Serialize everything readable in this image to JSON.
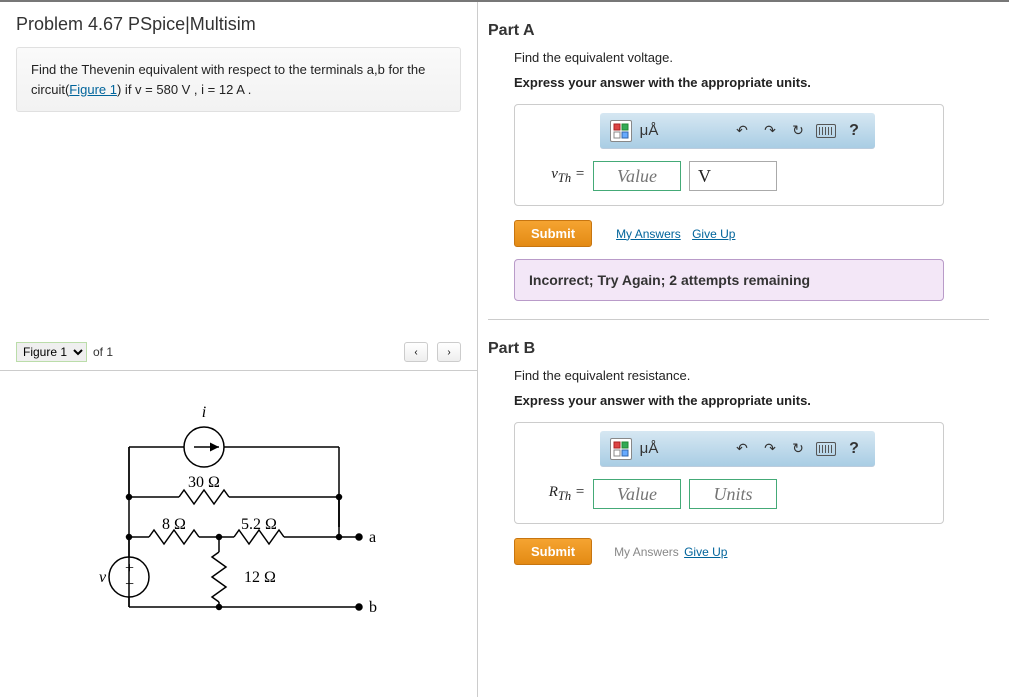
{
  "problem": {
    "title": "Problem 4.67 PSpice|Multisim",
    "description_pre": "Find the Thevenin equivalent with respect to the terminals a,b for the circuit(",
    "figure_link": "Figure 1",
    "description_post": ") if v = 580 V , i = 12 A ."
  },
  "figure": {
    "select_label": "Figure 1",
    "count_label": "of 1",
    "prev": "‹",
    "next": "›"
  },
  "circuit": {
    "i_label": "i",
    "r30": "30 Ω",
    "r8": "8 Ω",
    "r52": "5.2 Ω",
    "r12": "12 Ω",
    "v_label": "v",
    "term_a": "a",
    "term_b": "b"
  },
  "toolbar": {
    "units_label": "μÅ",
    "undo": "↶",
    "redo": "↷",
    "reset": "↻",
    "help": "?"
  },
  "partA": {
    "title": "Part A",
    "prompt": "Find the equivalent voltage.",
    "instr": "Express your answer with the appropriate units.",
    "var": "vTh =",
    "value_ph": "Value",
    "unit": "V",
    "submit": "Submit",
    "my_answers": "My Answers",
    "give_up": "Give Up",
    "feedback": "Incorrect; Try Again; 2 attempts remaining"
  },
  "partB": {
    "title": "Part B",
    "prompt": "Find the equivalent resistance.",
    "instr": "Express your answer with the appropriate units.",
    "var": "RTh =",
    "value_ph": "Value",
    "units_ph": "Units",
    "submit": "Submit",
    "my_answers": "My Answers",
    "give_up": "Give Up"
  }
}
